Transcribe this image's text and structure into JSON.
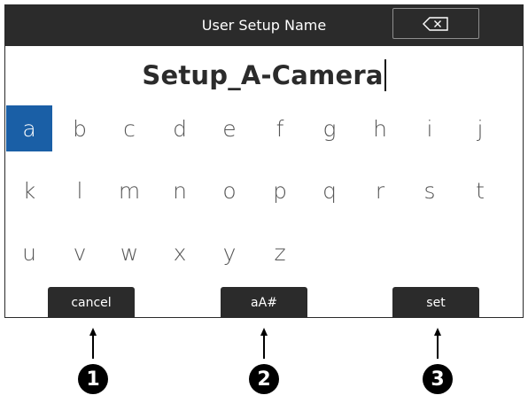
{
  "header": {
    "title": "User Setup Name",
    "backspace_icon": "backspace-icon"
  },
  "entry": {
    "value": "Setup_A-Camera"
  },
  "keyboard": {
    "rows": [
      [
        "a",
        "b",
        "c",
        "d",
        "e",
        "f",
        "g",
        "h",
        "i",
        "j"
      ],
      [
        "k",
        "l",
        "m",
        "n",
        "o",
        "p",
        "q",
        "r",
        "s",
        "t"
      ],
      [
        "u",
        "v",
        "w",
        "x",
        "y",
        "z"
      ]
    ],
    "selected": "a"
  },
  "buttons": {
    "cancel": "cancel",
    "mode": "aA#",
    "set": "set"
  },
  "callouts": [
    "1",
    "2",
    "3"
  ],
  "colors": {
    "bar": "#2b2b2b",
    "selected_key": "#1a5fa6"
  }
}
